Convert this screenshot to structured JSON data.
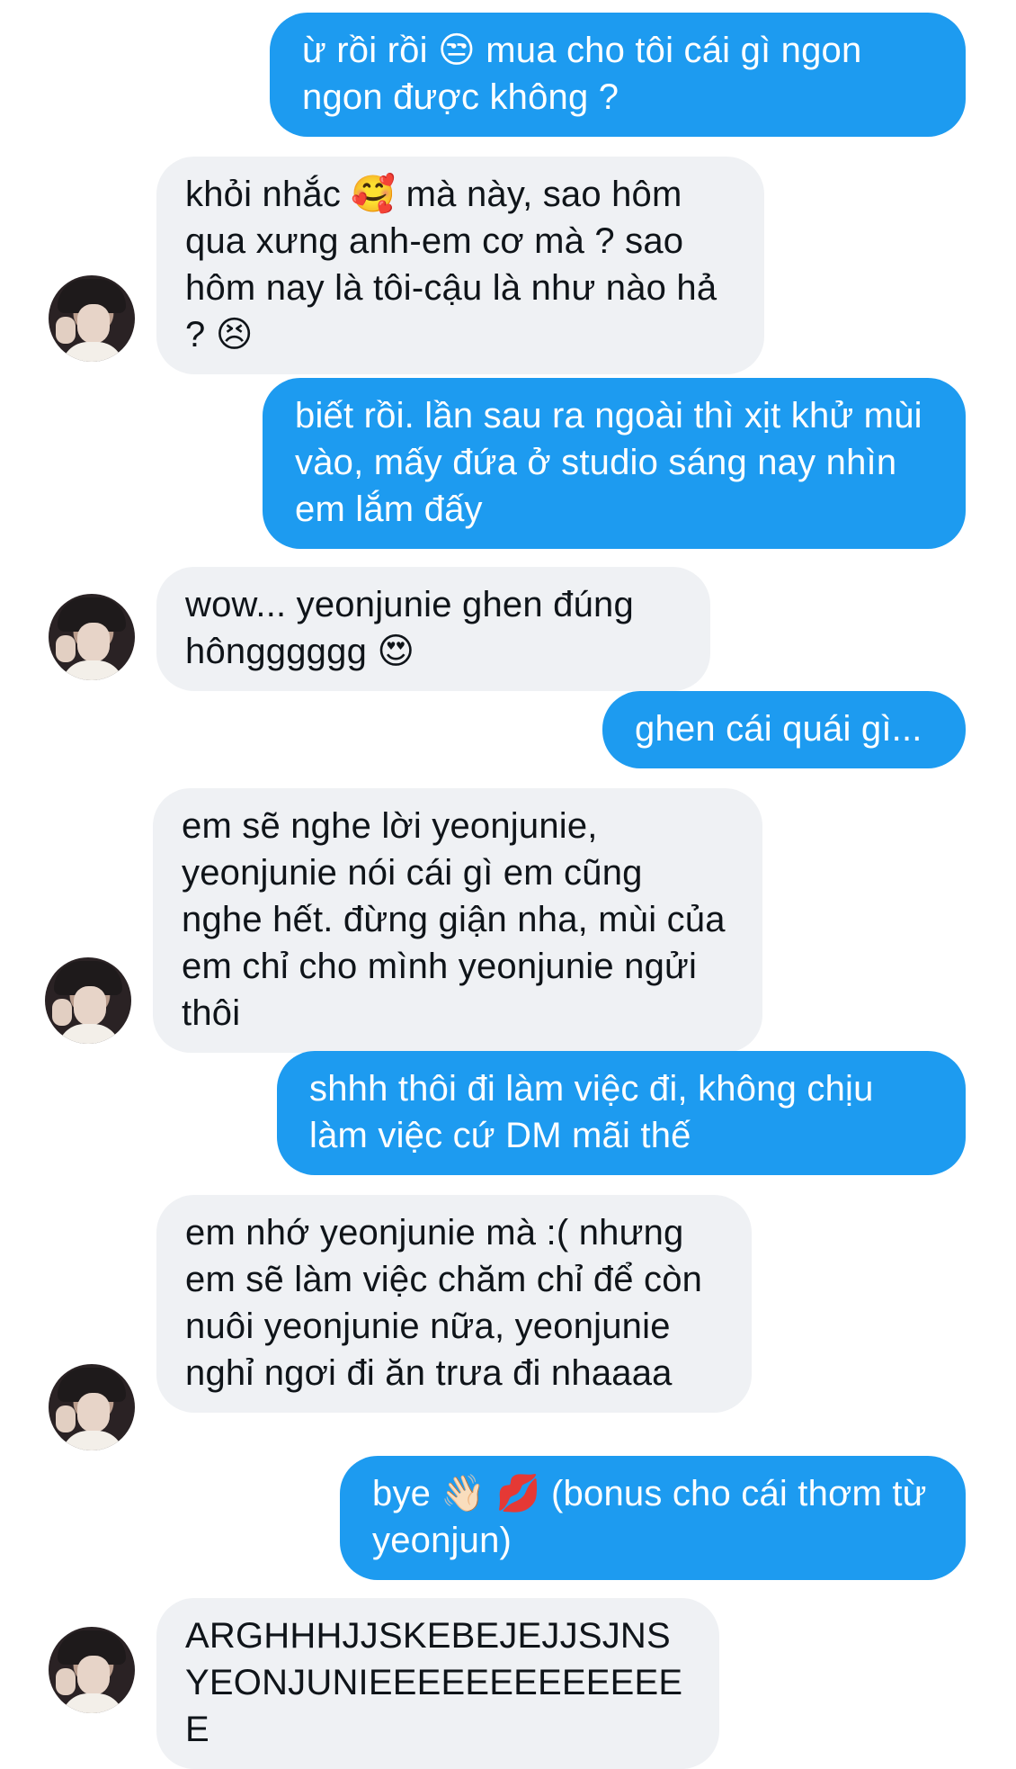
{
  "conversation": {
    "messages": [
      {
        "direction": "sent",
        "text": "ừ rồi rồi 😒 mua cho tôi cái gì ngon ngon được không ?"
      },
      {
        "direction": "received",
        "text": "khỏi nhắc 🥰 mà này, sao hôm qua xưng anh-em cơ mà ? sao hôm nay là tôi-cậu là như nào hả ? 😣"
      },
      {
        "direction": "sent",
        "text": "biết rồi. lần sau ra ngoài thì xịt khử mùi vào, mấy đứa ở studio sáng nay nhìn em lắm đấy"
      },
      {
        "direction": "received",
        "text": "wow... yeonjunie ghen đúng hôngggggg 😍"
      },
      {
        "direction": "sent",
        "text": "ghen cái quái gì..."
      },
      {
        "direction": "received",
        "text": "em sẽ nghe lời yeonjunie, yeonjunie nói cái gì em cũng nghe hết. đừng giận nha, mùi của em chỉ cho mình yeonjunie ngửi thôi"
      },
      {
        "direction": "sent",
        "text": "shhh thôi đi làm việc đi, không chịu làm việc cứ DM mãi thế"
      },
      {
        "direction": "received",
        "text": "em nhớ yeonjunie mà :( nhưng em sẽ làm việc chăm chỉ để còn nuôi yeonjunie nữa, yeonjunie nghỉ ngơi đi ăn trưa đi nhaaaa"
      },
      {
        "direction": "sent",
        "text": "bye 👋🏻 💋 (bonus cho cái thơm từ yeonjun)"
      },
      {
        "direction": "received",
        "text": "ARGHHHJJSKEBEJEJJSJNS YEONJUNIEEEEEEEEEEEEEE"
      }
    ]
  },
  "colors": {
    "sent_bubble": "#1d9bf0",
    "received_bubble": "#eff1f4",
    "sent_text": "#ffffff",
    "received_text": "#0f1419"
  }
}
